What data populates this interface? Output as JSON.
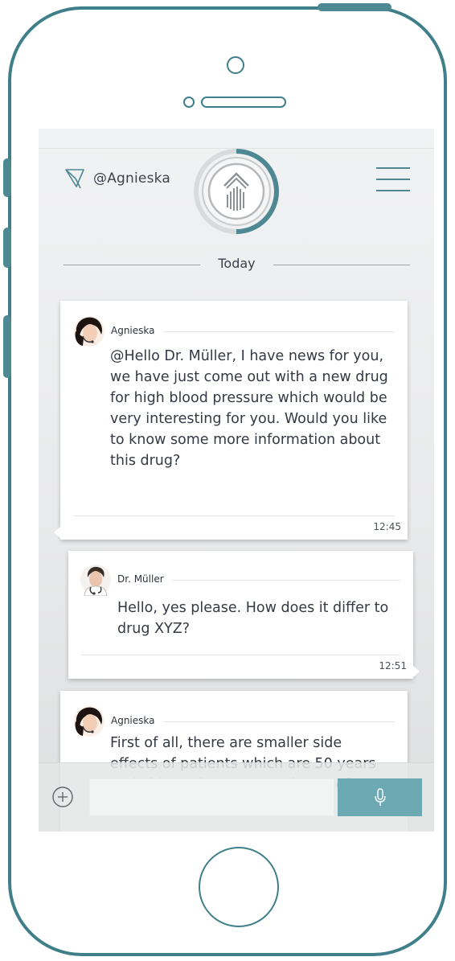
{
  "header": {
    "username": "@Agnieska"
  },
  "date_separator": "Today",
  "messages": [
    {
      "sender": "Agnieska",
      "text": "@Hello Dr. Müller, I have news for you, we have just come out with a new drug for high blood pressure which would be very interesting for you. Would you like to know some more information about this drug?",
      "time": "12:45",
      "avatar": "woman-headset-avatar"
    },
    {
      "sender": "Dr. Müller",
      "text": "Hello, yes please. How does it differ to drug XYZ?",
      "time": "12:51",
      "avatar": "doctor-avatar"
    },
    {
      "sender": "Agnieska",
      "text": "First of all, there are smaller side effects of patients which are 50 years and older. It is also a good type of angiotensin receptor blocker.",
      "time": "",
      "avatar": "woman-headset-avatar"
    }
  ],
  "composer": {
    "placeholder": "",
    "add_icon": "plus-circle-icon",
    "mic_icon": "microphone-icon"
  },
  "colors": {
    "accent": "#6da9b2",
    "frame": "#3f7f8a",
    "text": "#343a44"
  }
}
